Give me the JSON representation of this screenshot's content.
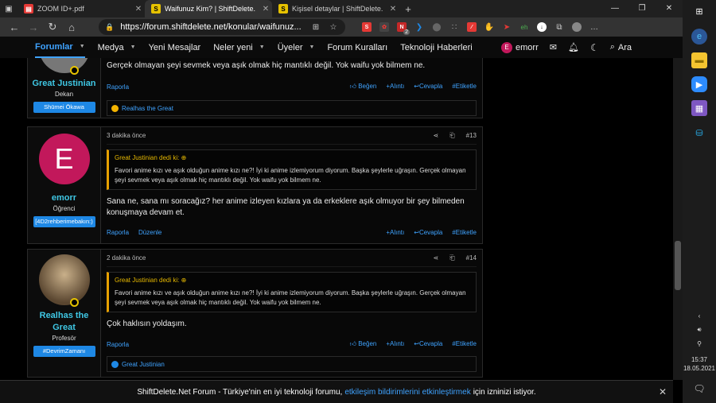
{
  "browser": {
    "tabs": [
      {
        "title": "ZOOM ID+.pdf",
        "icon": "pdf-icon",
        "color": "#e53935"
      },
      {
        "title": "Waifunuz Kim? | ShiftDelete.Net",
        "icon": "sdn-icon",
        "color": "#e6c200"
      },
      {
        "title": "Kişisel detaylar | ShiftDelete.Net",
        "icon": "sdn-icon",
        "color": "#e6c200"
      }
    ],
    "url": "https://forum.shiftdelete.net/konular/waifunuz...",
    "ext_badge": "2"
  },
  "nav": {
    "items": [
      "Forumlar",
      "Medya",
      "Yeni Mesajlar",
      "Neler yeni",
      "Üyeler",
      "Forum Kuralları",
      "Teknoloji Haberleri"
    ],
    "user_initial": "E",
    "username": "emorr",
    "search": "Ara"
  },
  "posts": [
    {
      "username": "Great Justinian",
      "role": "Dekan",
      "banner": "Shūmei Ōkawa",
      "text": "Gerçek olmayan şeyi sevmek veya aşık olmak hiç mantıklı değil. Yok waifu yok bilmem ne.",
      "footer_left": [
        "Raporla"
      ],
      "actions": [
        "Beğen",
        "Alıntı",
        "Cevapla",
        "#Etiketle"
      ],
      "reactions": "Realhas the Great"
    },
    {
      "time": "3 dakika önce",
      "number": "#13",
      "avatar_initial": "E",
      "username": "emorr",
      "role": "Öğrenci",
      "banner": "[4D2rehberimebakın:)",
      "quote_head": "Great Justinian dedi ki:",
      "quote_text": "Favori anime kızı ve aşık olduğun anime kızı ne?! İyi ki anime izlemiyorum diyorum. Başka şeylerle uğraşın. Gerçek olmayan şeyi sevmek veya aşık olmak hiç mantıklı değil. Yok waifu yok bilmem ne.",
      "text": "Sana ne, sana mı soracağız? her anime izleyen kızlara ya da erkeklere aşık olmuyor bir şey bilmeden konuşmaya devam et.",
      "footer_left": [
        "Raporla",
        "Düzenle"
      ],
      "actions": [
        "Alıntı",
        "Cevapla",
        "#Etiketle"
      ]
    },
    {
      "time": "2 dakika önce",
      "number": "#14",
      "username": "Realhas the Great",
      "role": "Profesör",
      "banner": "#DevrimZamanı",
      "quote_head": "Great Justinian dedi ki:",
      "quote_text": "Favori anime kızı ve aşık olduğun anime kızı ne?! İyi ki anime izlemiyorum diyorum. Başka şeylerle uğraşın. Gerçek olmayan şeyi sevmek veya aşık olmak hiç mantıklı değil. Yok waifu yok bilmem ne.",
      "text": "Çok haklısın yoldaşım.",
      "footer_left": [
        "Raporla"
      ],
      "actions": [
        "Beğen",
        "Alıntı",
        "Cevapla",
        "#Etiketle"
      ],
      "reactions": "Great Justinian"
    }
  ],
  "notification": {
    "prefix": "ShiftDelete.Net Forum - Türkiye'nin en iyi teknoloji forumu,",
    "link": "etkileşim bildirimlerini etkinleştirmek",
    "suffix": "için izninizi istiyor."
  },
  "taskbar": {
    "time": "15:37",
    "date": "18.05.2021"
  },
  "colors": {
    "accent": "#3fa3ff",
    "username": "#3fc7e4",
    "quote": "#e6b800",
    "banner": "#1e88e5"
  }
}
